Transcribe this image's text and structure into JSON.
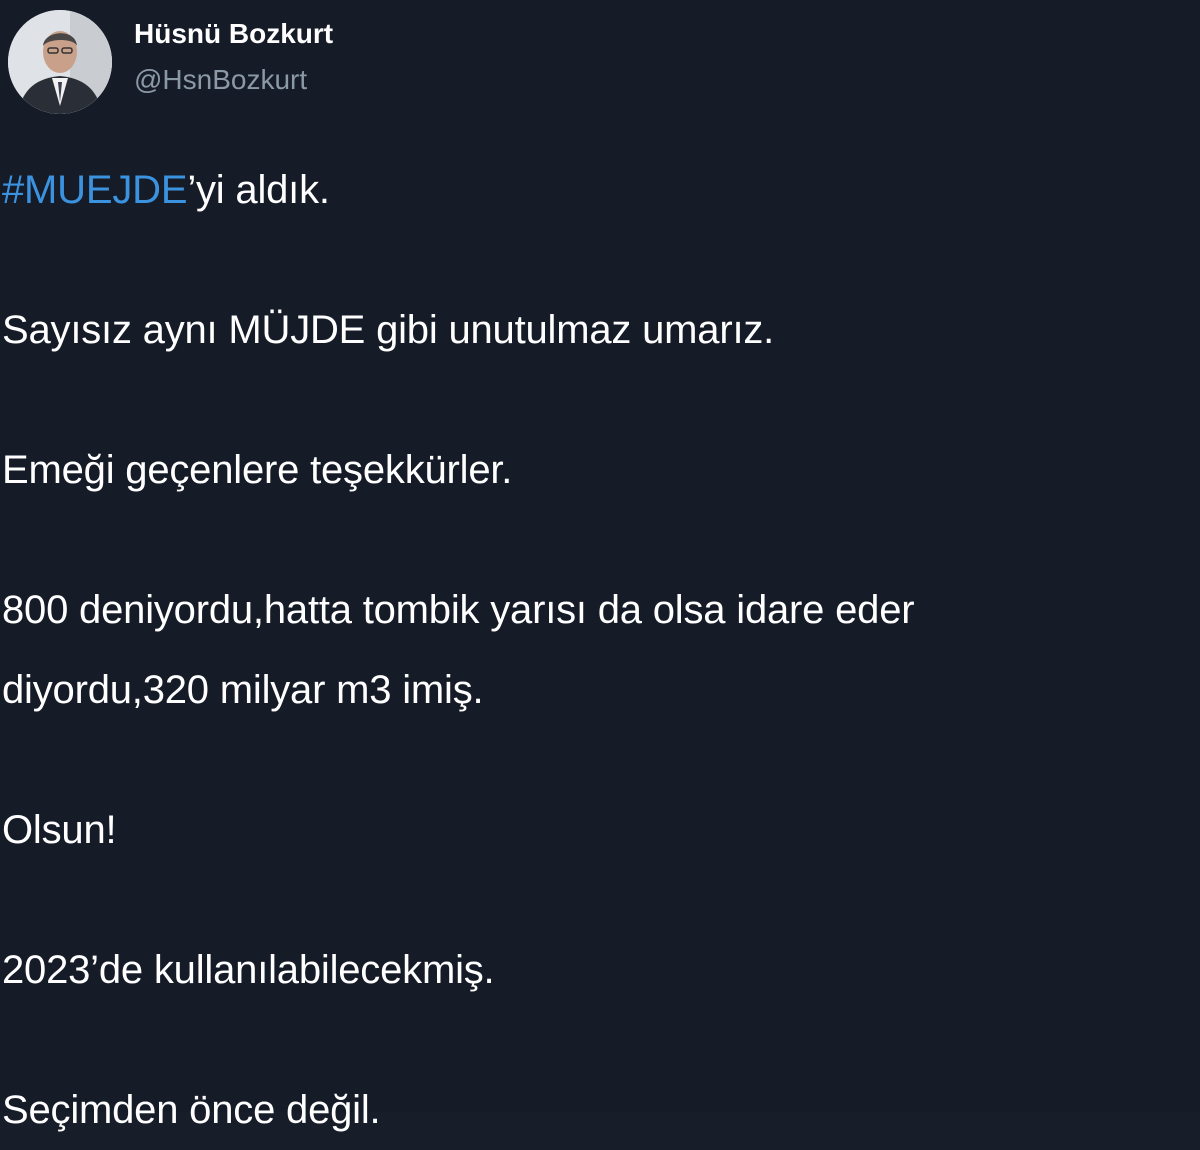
{
  "user": {
    "display_name": "Hüsnü Bozkurt",
    "handle": "@HsnBozkurt",
    "avatar_icon": "profile-photo"
  },
  "tweet": {
    "hashtag": "#MUEJDE",
    "first_line_rest": "’yi aldık.",
    "lines": [
      "Sayısız aynı MÜJDE gibi unutulmaz umarız.",
      "Emeği geçenlere teşekkürler.",
      "800 deniyordu,hatta tombik yarısı da olsa idare eder",
      "diyordu,320 milyar m3 imiş.",
      "Olsun!",
      "2023’de kullanılabilecekmiş.",
      "Seçimden önce değil."
    ]
  },
  "colors": {
    "background": "#161b28",
    "text": "#ffffff",
    "handle": "#8b98a5",
    "hashtag": "#3b93e0"
  }
}
